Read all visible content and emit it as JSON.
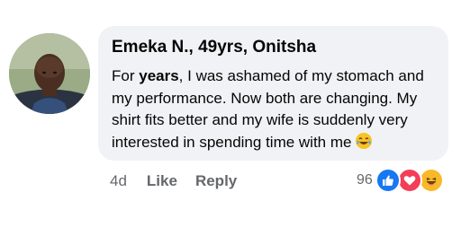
{
  "comment": {
    "author": "Emeka N., 49yrs, Onitsha",
    "text_before": "For ",
    "text_emphasis": "years",
    "text_after": ", I was ashamed of my stomach and my performance. Now both are changing. My shirt fits better and my wife is suddenly very interested in spending time with me",
    "inline_emoji": "laughing-tears-emoji"
  },
  "actions": {
    "age": "4d",
    "like_label": "Like",
    "reply_label": "Reply"
  },
  "reactions": {
    "count": "96",
    "icons": [
      "like-icon",
      "love-icon",
      "haha-icon"
    ],
    "colors": {
      "like": "#1877f2",
      "love": "#f33e58",
      "haha": "#f7b928"
    }
  }
}
